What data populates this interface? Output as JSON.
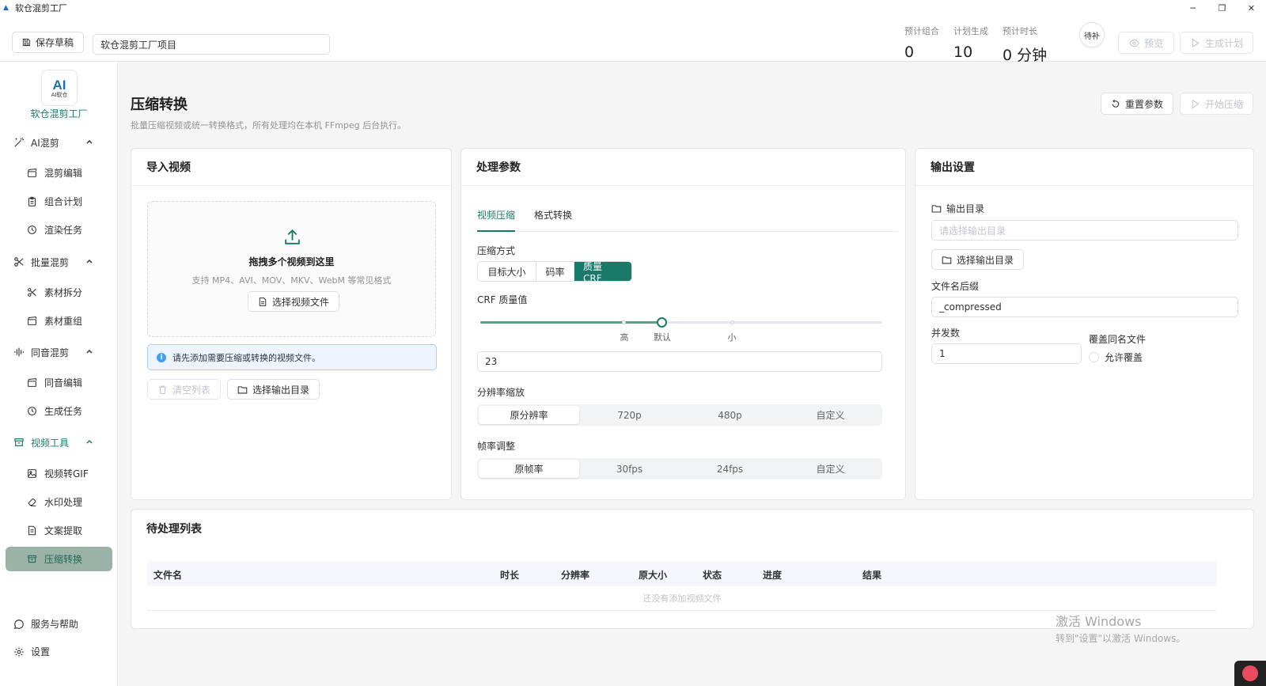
{
  "window": {
    "title": "软仓混剪工厂",
    "controls": {
      "minimize": "─",
      "restore": "❐",
      "close": "✕"
    }
  },
  "header": {
    "save_draft": "保存草稿",
    "project_name": "软仓混剪工厂项目",
    "stats": [
      {
        "label": "预计组合",
        "value": "0"
      },
      {
        "label": "计划生成",
        "value": "10"
      },
      {
        "label": "预计时长",
        "value": "0 分钟"
      }
    ],
    "badge": "待补",
    "preview": "预览",
    "generate_plan": "生成计划"
  },
  "sidebar": {
    "logo_main": "AI",
    "logo_sub": "AI软仓",
    "brand": "软仓混剪工厂",
    "groups": [
      {
        "label": "AI混剪",
        "items": [
          "混剪编辑",
          "组合计划",
          "渲染任务"
        ]
      },
      {
        "label": "批量混剪",
        "items": [
          "素材拆分",
          "素材重组"
        ]
      },
      {
        "label": "同音混剪",
        "items": [
          "同音编辑",
          "生成任务"
        ]
      },
      {
        "label": "视频工具",
        "items": [
          "视频转GIF",
          "水印处理",
          "文案提取",
          "压缩转换"
        ]
      }
    ],
    "footer": {
      "help": "服务与帮助",
      "settings": "设置"
    }
  },
  "page": {
    "title": "压缩转换",
    "subtitle": "批量压缩视频或统一转换格式，所有处理均在本机 FFmpeg 后台执行。",
    "reset": "重置参数",
    "start": "开始压缩"
  },
  "import_card": {
    "title": "导入视频",
    "drop_title": "拖拽多个视频到这里",
    "drop_sub": "支持 MP4、AVI、MOV、MKV、WebM 等常见格式",
    "select_files": "选择视频文件",
    "alert": "请先添加需要压缩或转换的视频文件。",
    "clear_list": "清空列表",
    "select_output": "选择输出目录"
  },
  "params_card": {
    "title": "处理参数",
    "tabs": [
      "视频压缩",
      "格式转换"
    ],
    "compress_mode_label": "压缩方式",
    "compress_modes": [
      "目标大小",
      "码率",
      "质量 CRF"
    ],
    "crf_label": "CRF 质量值",
    "crf_marks": [
      "高",
      "默认",
      "小"
    ],
    "crf_level": 0.45,
    "crf_value": "23",
    "resolution_label": "分辨率缩放",
    "resolutions": [
      "原分辨率",
      "720p",
      "480p",
      "自定义"
    ],
    "fps_label": "帧率调整",
    "fps_options": [
      "原帧率",
      "30fps",
      "24fps",
      "自定义"
    ]
  },
  "output_card": {
    "title": "输出设置",
    "dir_label": "输出目录",
    "dir_placeholder": "请选择输出目录",
    "select_dir": "选择输出目录",
    "suffix_label": "文件名后缀",
    "suffix_value": "_compressed",
    "concurrency_label": "并发数",
    "concurrency_value": "1",
    "overwrite_label": "覆盖同名文件",
    "overwrite_option": "允许覆盖"
  },
  "queue_card": {
    "title": "待处理列表",
    "columns": [
      "文件名",
      "时长",
      "分辨率",
      "原大小",
      "状态",
      "进度",
      "结果"
    ],
    "empty": "还没有添加视频文件"
  },
  "watermark": {
    "line1": "激活 Windows",
    "line2": "转到\"设置\"以激活 Windows。"
  }
}
